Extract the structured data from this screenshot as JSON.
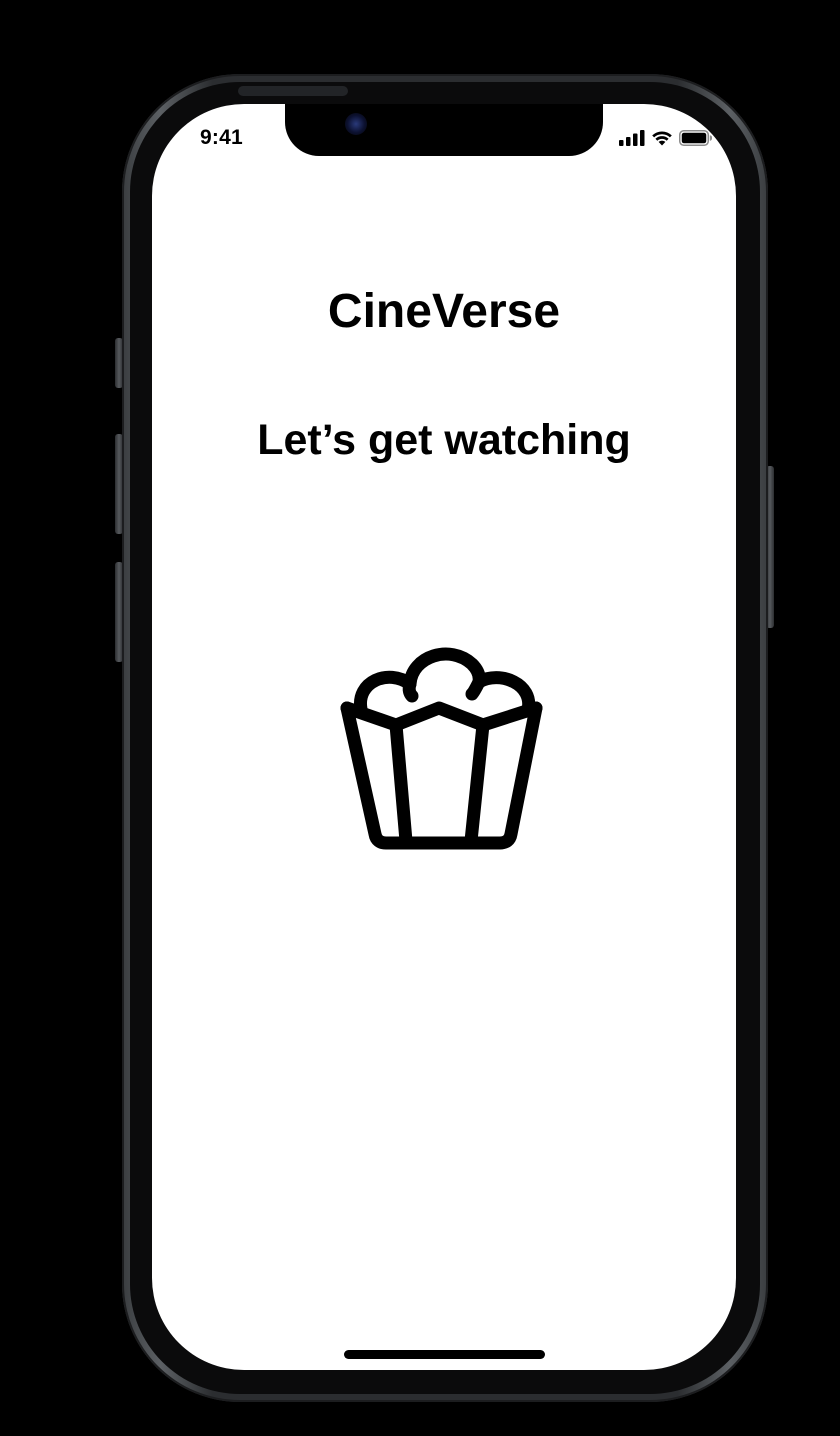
{
  "status_bar": {
    "time": "9:41",
    "signal_icon": "cellular-signal-icon",
    "wifi_icon": "wifi-icon",
    "battery_icon": "battery-icon"
  },
  "onboarding": {
    "app_name": "CineVerse",
    "tagline": "Let’s get watching",
    "illustration_icon": "popcorn-icon"
  },
  "colors": {
    "background": "#ffffff",
    "text": "#000000",
    "device_frame": "#2b2d30"
  }
}
